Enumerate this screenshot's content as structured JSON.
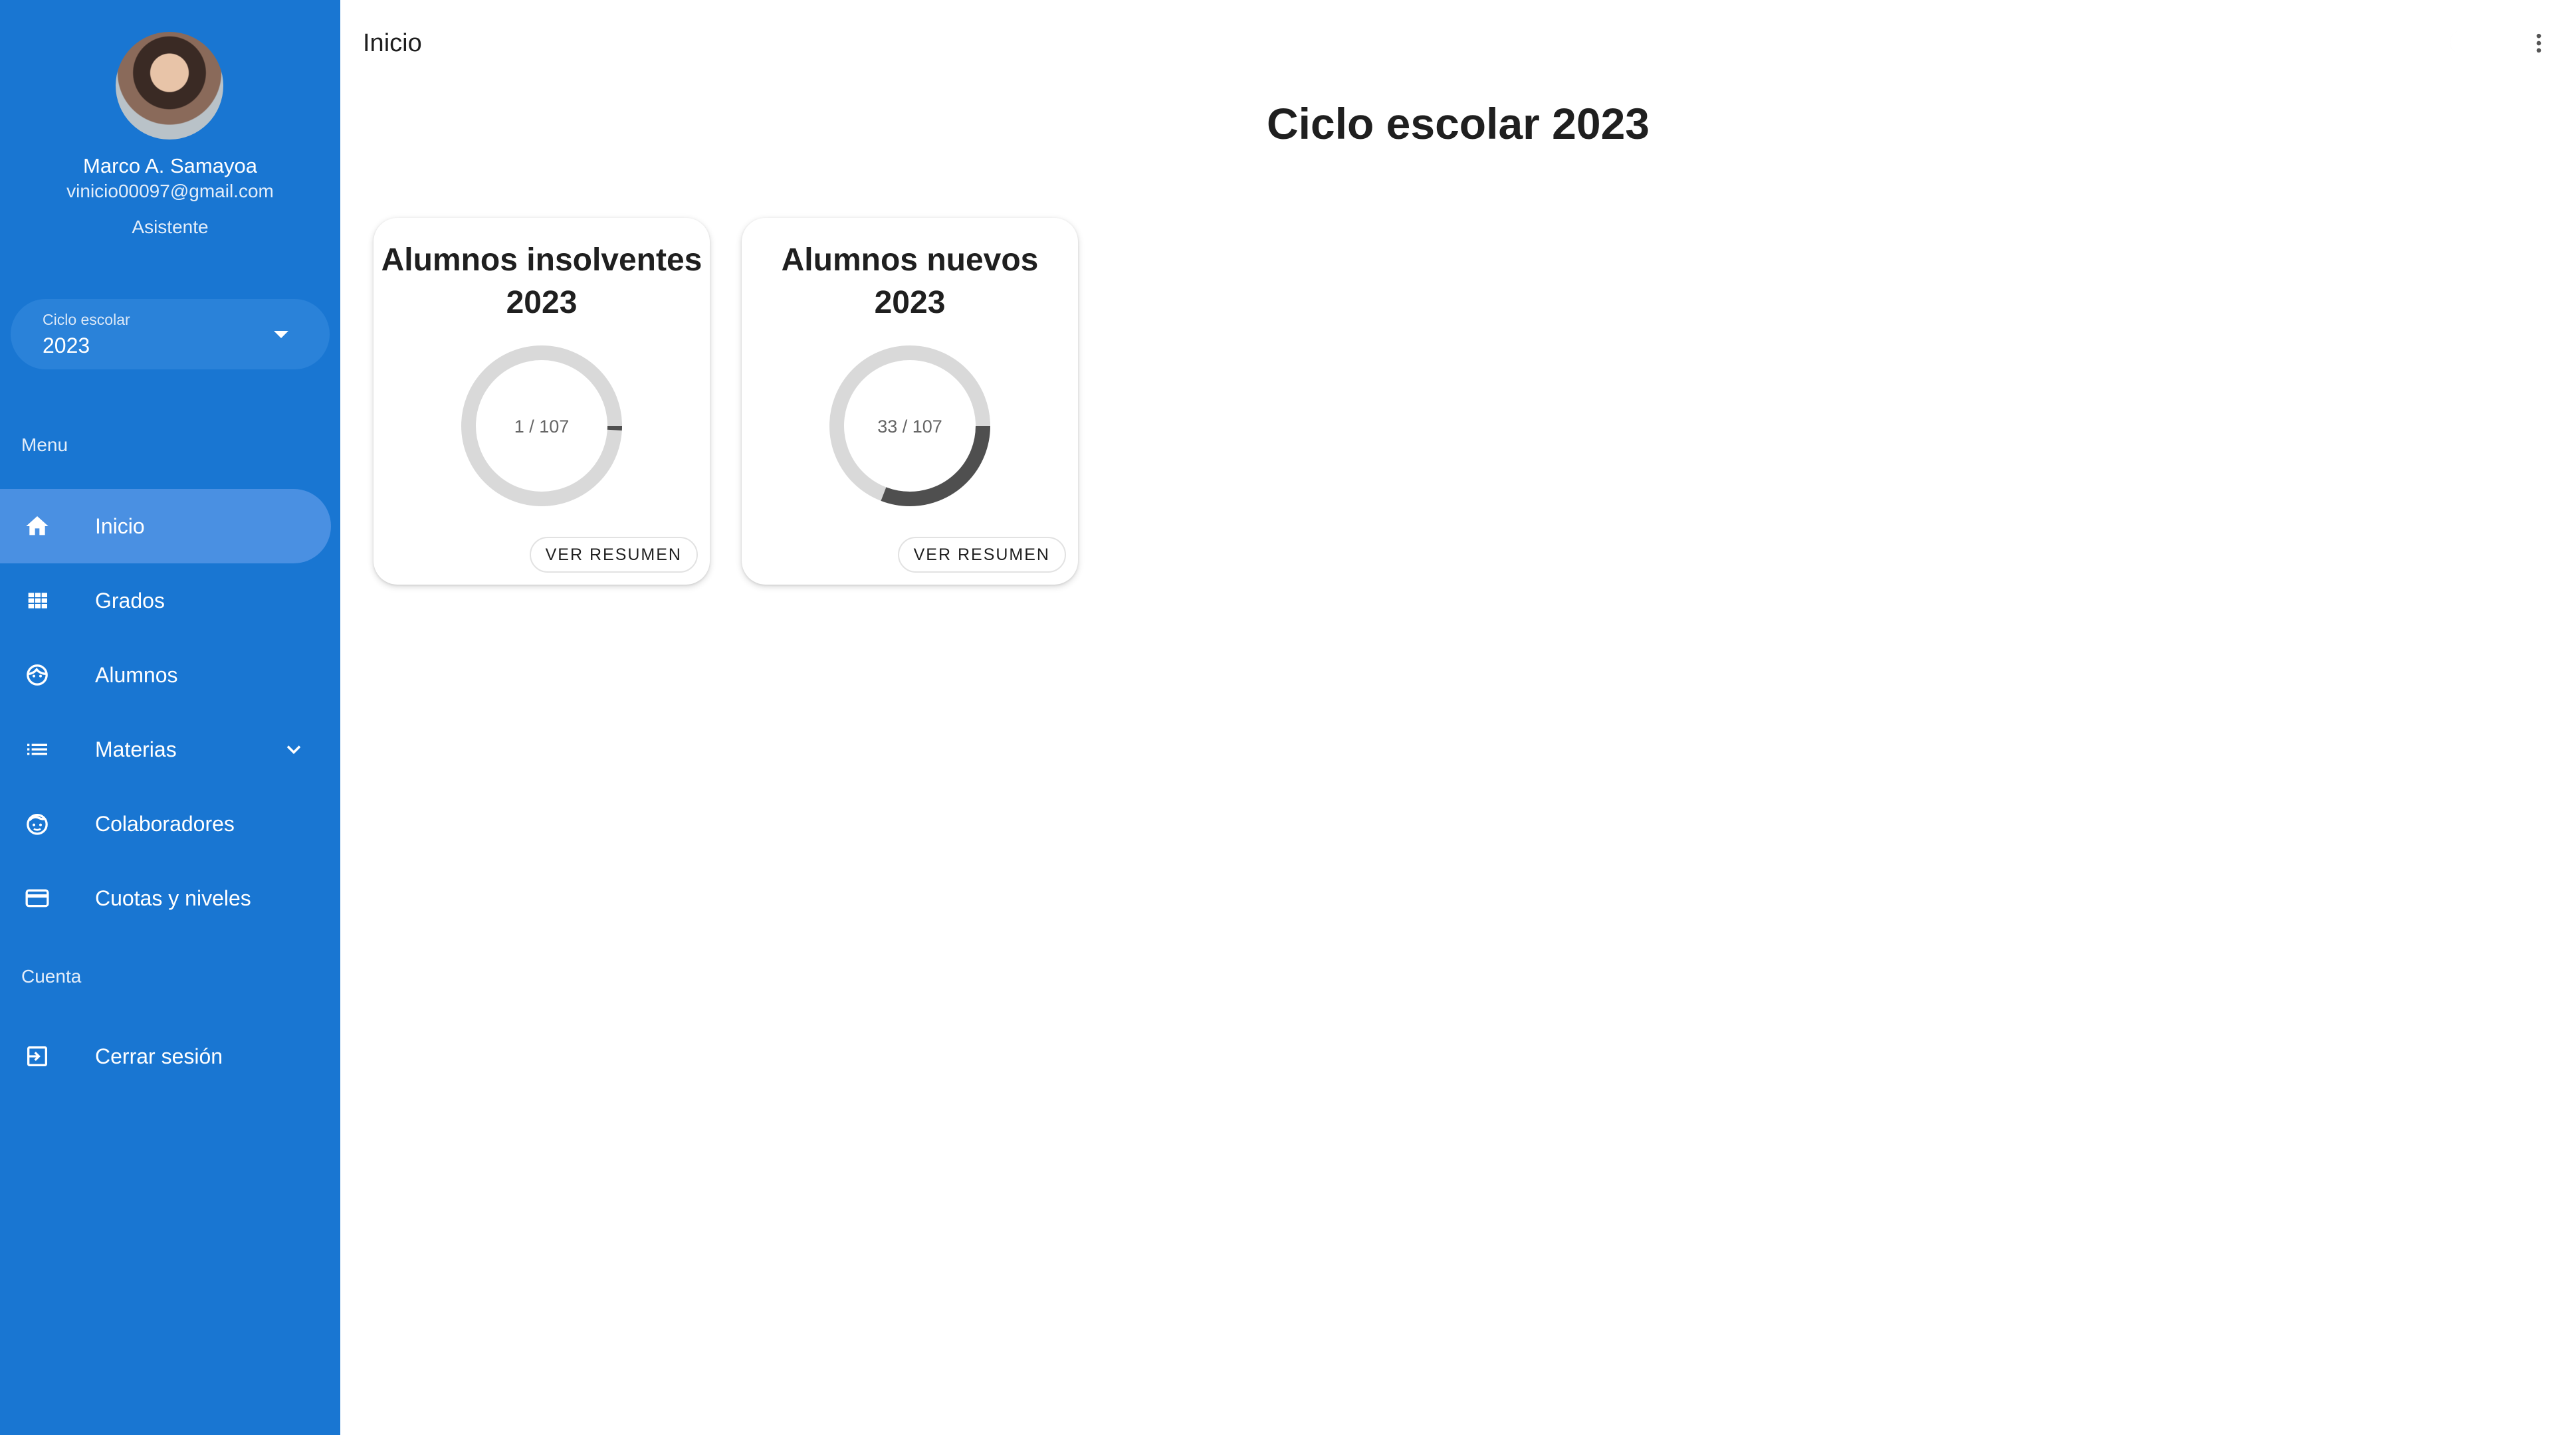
{
  "topbar": {
    "title": "Inicio"
  },
  "user": {
    "name": "Marco A. Samayoa",
    "email": "vinicio00097@gmail.com",
    "role": "Asistente"
  },
  "cycle_select": {
    "label": "Ciclo escolar",
    "value": "2023"
  },
  "sections": {
    "menu": "Menu",
    "account": "Cuenta"
  },
  "nav": [
    {
      "label": "Inicio",
      "icon": "home-icon",
      "active": true
    },
    {
      "label": "Grados",
      "icon": "grid-icon"
    },
    {
      "label": "Alumnos",
      "icon": "face-icon"
    },
    {
      "label": "Materias",
      "icon": "list-icon"
    },
    {
      "label": "Colaboradores",
      "icon": "child-face-icon"
    },
    {
      "label": "Cuotas y niveles",
      "icon": "credit-card-icon"
    }
  ],
  "logout": {
    "label": "Cerrar sesión",
    "icon": "logout-icon"
  },
  "page": {
    "heading": "Ciclo escolar 2023"
  },
  "cards": [
    {
      "title_line1": "Alumnos insolventes",
      "title_line2": "2023",
      "value": 1,
      "total": 107,
      "label": "1 / 107",
      "button": "VER RESUMEN"
    },
    {
      "title_line1": "Alumnos nuevos",
      "title_line2": "2023",
      "value": 33,
      "total": 107,
      "label": "33 / 107",
      "button": "VER RESUMEN"
    }
  ],
  "colors": {
    "sidebar": "#1976d2",
    "active_item": "#4a90e2",
    "donut_track": "#d9d9d9",
    "donut_fill": "#4f4f4f"
  }
}
